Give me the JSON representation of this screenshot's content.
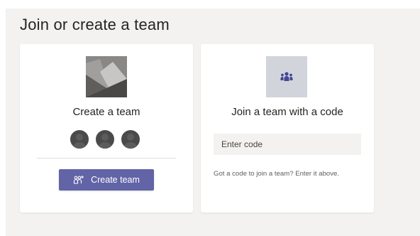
{
  "page": {
    "title": "Join or create a team"
  },
  "create_card": {
    "title": "Create a team",
    "button_label": "Create team",
    "image_icon": "team-image-placeholder-icon",
    "button_icon": "add-team-icon",
    "avatars": [
      "avatar-1",
      "avatar-2",
      "avatar-3"
    ]
  },
  "join_card": {
    "title": "Join a team with a code",
    "input_value": "",
    "input_placeholder": "Enter code",
    "hint": "Got a code to join a team? Enter it above.",
    "icon": "team-people-icon"
  },
  "colors": {
    "accent": "#6264a7",
    "panel_bg": "#f3f2f1",
    "icon_tile_bg": "#d2d4dc"
  }
}
